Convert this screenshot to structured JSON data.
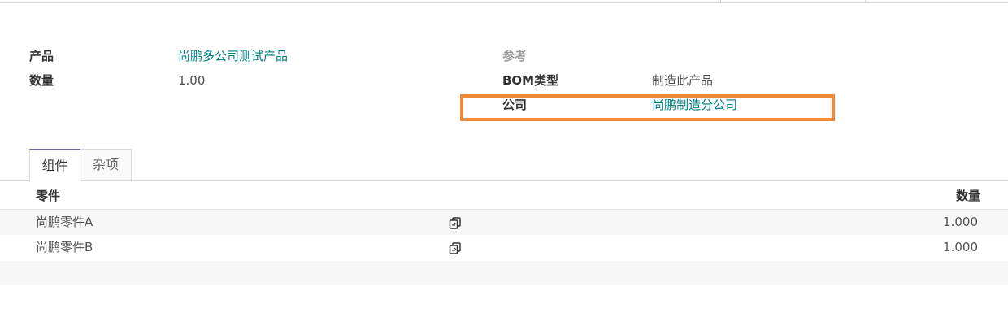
{
  "form": {
    "product_label": "产品",
    "product_value": "尚鹏多公司测试产品",
    "quantity_label": "数量",
    "quantity_value": "1.00",
    "reference_label": "参考",
    "reference_value": "",
    "bom_type_label": "BOM类型",
    "bom_type_value": "制造此产品",
    "company_label": "公司",
    "company_value": "尚鹏制造分公司"
  },
  "tabs": [
    {
      "label": "组件",
      "active": true
    },
    {
      "label": "杂项",
      "active": false
    }
  ],
  "table": {
    "columns": [
      "零件",
      "数量"
    ],
    "rows": [
      {
        "component": "尚鹏零件A",
        "quantity": "1.000"
      },
      {
        "component": "尚鹏零件B",
        "quantity": "1.000"
      }
    ]
  },
  "colors": {
    "link": "#017e84",
    "highlight": "#ef8a3b",
    "tab_accent": "#71639e"
  },
  "icons": {
    "copy": "copy-icon"
  }
}
